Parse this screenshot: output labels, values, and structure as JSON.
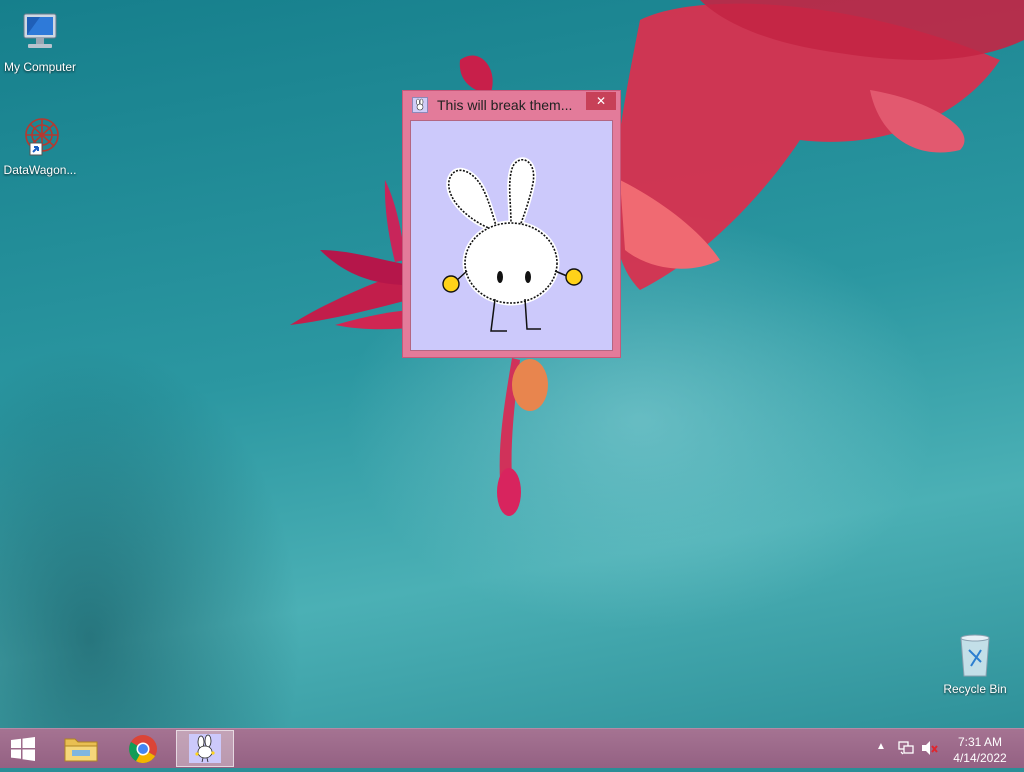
{
  "desktop": {
    "icons": [
      {
        "label": "My Computer",
        "icon": "my-computer-icon"
      },
      {
        "label": "DataWagon...",
        "icon": "datawagon-icon"
      },
      {
        "label": "Recycle Bin",
        "icon": "recycle-bin-icon"
      }
    ]
  },
  "window": {
    "title": "This will break them...",
    "close_glyph": "✕",
    "icon": "bunny-icon",
    "content_image": "bunny-drawing"
  },
  "taskbar": {
    "start_icon": "windows-logo-icon",
    "pinned": [
      {
        "name": "file-explorer",
        "icon": "folder-icon"
      },
      {
        "name": "chrome",
        "icon": "chrome-icon"
      },
      {
        "name": "bunny-app",
        "icon": "bunny-icon",
        "active": true
      }
    ],
    "tray": {
      "arrow": "▲",
      "time": "7:31 AM",
      "date": "4/14/2022"
    }
  },
  "colors": {
    "taskbar": "#9d6a8c",
    "window_frame": "#e37b9a",
    "window_client": "#ccc9fb",
    "close_button": "#c74158"
  }
}
